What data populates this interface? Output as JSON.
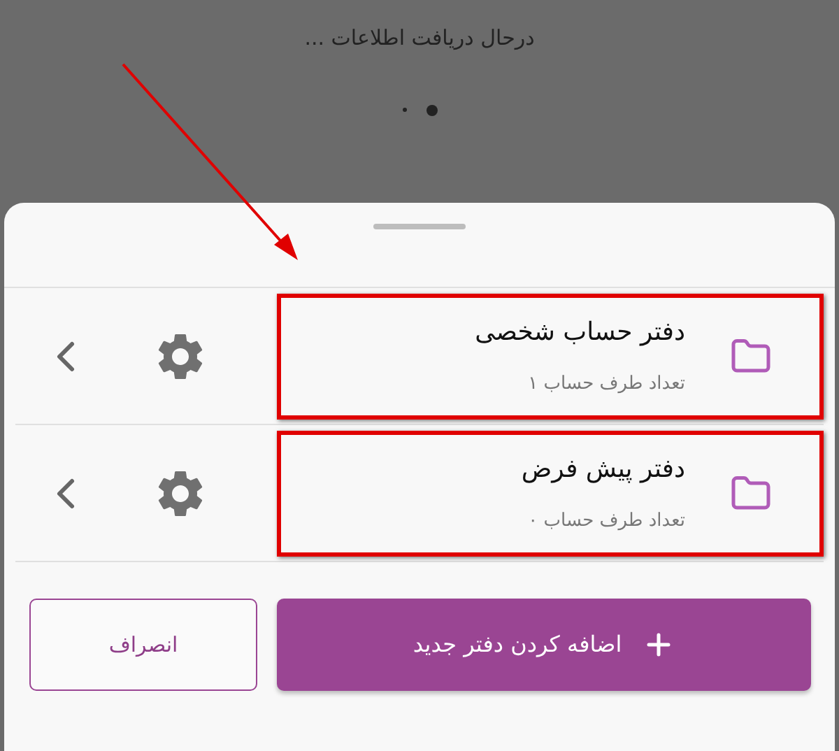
{
  "loading": {
    "message": "درحال دریافت اطلاعات ...",
    "dots": [
      {
        "selected": false
      },
      {
        "selected": true
      }
    ]
  },
  "annotation": {
    "arrow": true
  },
  "notebooks": [
    {
      "title": "دفتر حساب شخصی",
      "subtitle": "تعداد طرف حساب ۱",
      "highlighted": true
    },
    {
      "title": "دفتر پیش فرض",
      "subtitle": "تعداد طرف حساب ۰",
      "highlighted": true
    }
  ],
  "buttons": {
    "add": "اضافه کردن دفتر جدید",
    "cancel": "انصراف"
  }
}
